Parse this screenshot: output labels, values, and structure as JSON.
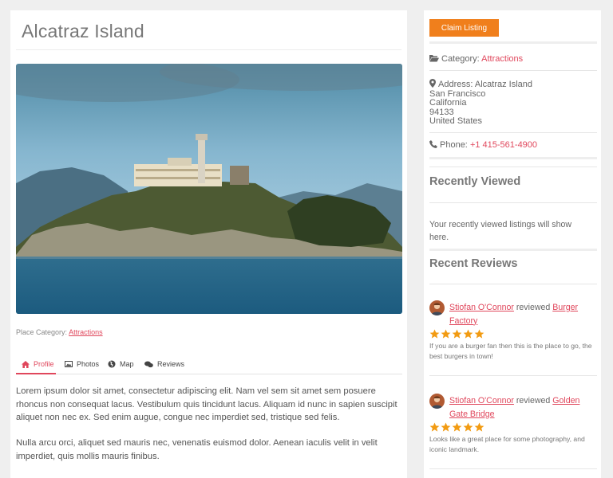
{
  "listing": {
    "title": "Alcatraz Island",
    "image_alt": "Alcatraz Island photo",
    "place_category_label": "Place Category:",
    "place_category_value": "Attractions"
  },
  "tabs": [
    {
      "label": "Profile",
      "icon": "home-icon",
      "active": true
    },
    {
      "label": "Photos",
      "icon": "image-icon",
      "active": false
    },
    {
      "label": "Map",
      "icon": "globe-icon",
      "active": false
    },
    {
      "label": "Reviews",
      "icon": "comments-icon",
      "active": false
    }
  ],
  "description": {
    "p1": "Lorem ipsum dolor sit amet, consectetur adipiscing elit. Nam vel sem sit amet sem posuere rhoncus non consequat lacus. Vestibulum quis tincidunt lacus. Aliquam id nunc in sapien suscipit aliquet non nec ex. Sed enim augue, congue nec imperdiet sed, tristique sed felis.",
    "p2": "Nulla arcu orci, aliquet sed mauris nec, venenatis euismod dolor. Aenean iaculis velit in velit imperdiet, quis mollis mauris finibus."
  },
  "sidebar": {
    "claim_button": "Claim Listing",
    "category_label": "Category:",
    "category_value": "Attractions",
    "address_label": "Address:",
    "address_line1": "Alcatraz Island",
    "address_city": "San Francisco",
    "address_state": "California",
    "address_zip": "94133",
    "address_country": "United States",
    "phone_label": "Phone:",
    "phone_value": "+1 415-561-4900",
    "recently_viewed_title": "Recently Viewed",
    "recently_viewed_text": "Your recently viewed listings will show here.",
    "recent_reviews_title": "Recent Reviews",
    "reviews": [
      {
        "author": "Stiofan O'Connor",
        "verb": "reviewed",
        "place": "Burger Factory",
        "rating": 5,
        "text": "If you are a burger fan then this is the place to go, the best burgers in town!"
      },
      {
        "author": "Stiofan O'Connor",
        "verb": "reviewed",
        "place": "Golden Gate Bridge",
        "rating": 5,
        "text": "Looks like a great place for some photography, and iconic landmark."
      }
    ]
  },
  "colors": {
    "accent": "#e0475c",
    "button": "#f07f1c",
    "star": "#f29b12"
  }
}
